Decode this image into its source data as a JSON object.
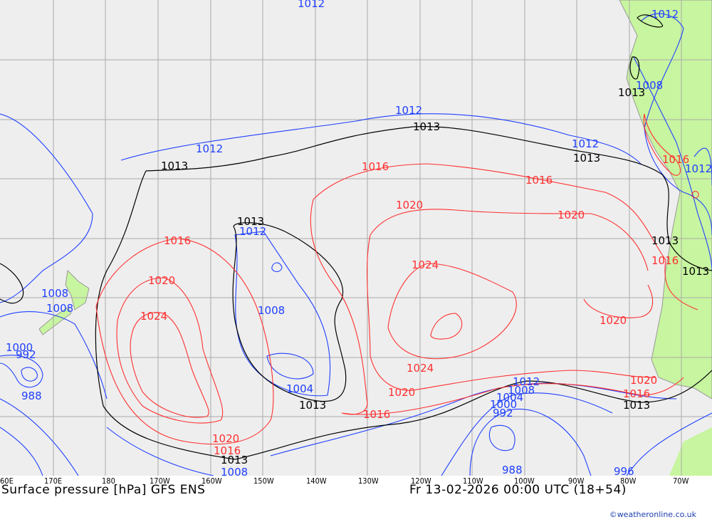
{
  "title": "Surface pressure [hPa] GFS ENS",
  "valid_time": "Fr 13-02-2026 00:00 UTC (18+54)",
  "credit": "©weatheronline.co.uk",
  "colors": {
    "ocean": "#eeeeee",
    "land": "#c8f5a0",
    "grid": "#aaaaaa",
    "low": "#2040ff",
    "high": "#ff3030",
    "standard": "#000000"
  },
  "longitude_ticks": [
    "60E",
    "170E",
    "180",
    "170W",
    "160W",
    "150W",
    "140W",
    "130W",
    "120W",
    "110W",
    "100W",
    "90W",
    "80W",
    "70W"
  ],
  "isobar_labels": {
    "blue": [
      "1012",
      "1012",
      "1012",
      "1012",
      "1012",
      "1012",
      "1008",
      "1008",
      "1008",
      "1008",
      "1004",
      "1000",
      "992",
      "988",
      "1012",
      "1008",
      "1004",
      "1000",
      "992",
      "988",
      "996",
      "1008",
      "1012"
    ],
    "black": [
      "1013",
      "1013",
      "1013",
      "1013",
      "1013",
      "1013",
      "1013",
      "1013",
      "1013"
    ],
    "red": [
      "1016",
      "1016",
      "1016",
      "1016",
      "1016",
      "1016",
      "1016",
      "1016",
      "1020",
      "1020",
      "1020",
      "1020",
      "1020",
      "1020",
      "1024",
      "1024",
      "1024"
    ]
  }
}
